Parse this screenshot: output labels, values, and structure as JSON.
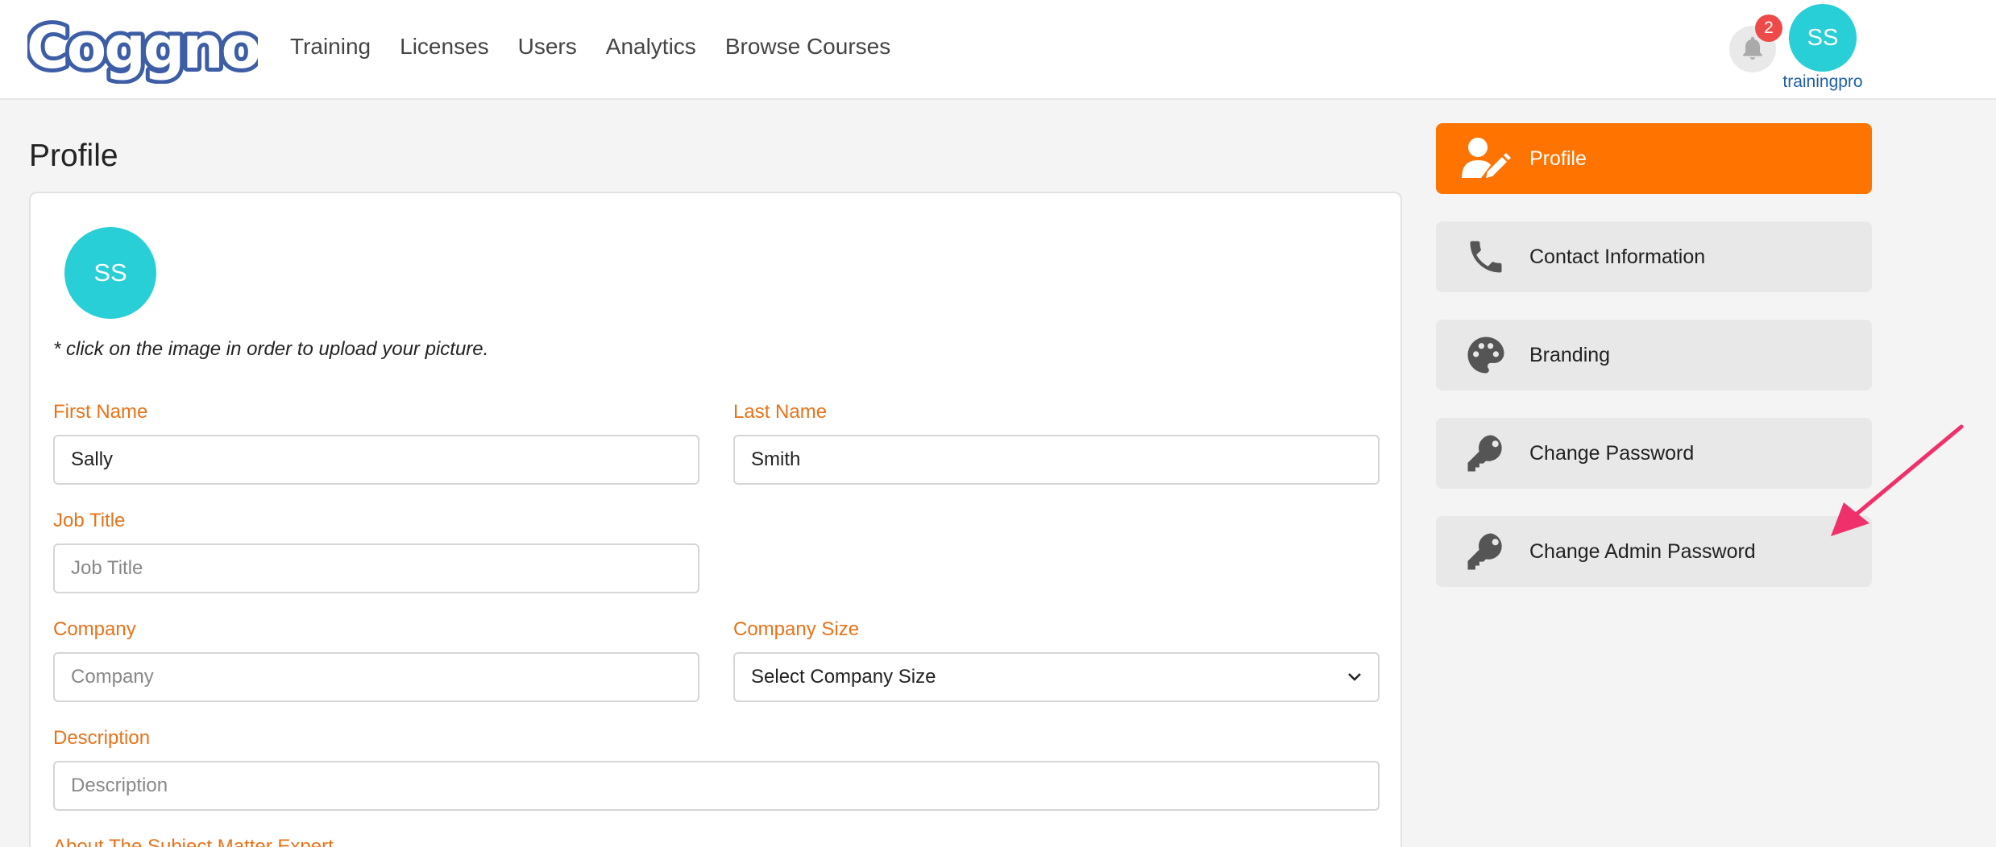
{
  "header": {
    "logo_text": "Coggno",
    "nav": [
      {
        "label": "Training"
      },
      {
        "label": "Licenses"
      },
      {
        "label": "Users"
      },
      {
        "label": "Analytics"
      },
      {
        "label": "Browse Courses"
      }
    ],
    "notification_count": "2",
    "avatar_initials": "SS",
    "username": "trainingpro"
  },
  "main": {
    "title": "Profile",
    "avatar_initials": "SS",
    "upload_hint": "* click on the image in order to upload your picture.",
    "fields": {
      "first_name": {
        "label": "First Name",
        "value": "Sally"
      },
      "last_name": {
        "label": "Last Name",
        "value": "Smith"
      },
      "job_title": {
        "label": "Job Title",
        "value": "",
        "placeholder": "Job Title"
      },
      "company": {
        "label": "Company",
        "value": "",
        "placeholder": "Company"
      },
      "company_size": {
        "label": "Company Size",
        "selected": "Select Company Size"
      },
      "description": {
        "label": "Description",
        "value": "",
        "placeholder": "Description"
      },
      "about_sme": {
        "label": "About The Subject Matter Expert"
      }
    }
  },
  "sidebar": {
    "items": [
      {
        "label": "Profile",
        "icon": "user-edit-icon",
        "active": true
      },
      {
        "label": "Contact Information",
        "icon": "phone-icon",
        "active": false
      },
      {
        "label": "Branding",
        "icon": "palette-icon",
        "active": false
      },
      {
        "label": "Change Password",
        "icon": "key-icon",
        "active": false
      },
      {
        "label": "Change Admin Password",
        "icon": "key-icon",
        "active": false
      }
    ]
  },
  "colors": {
    "accent_orange": "#ff7300",
    "label_orange": "#e8731a",
    "avatar_teal": "#29cfd6",
    "logo_blue": "#3d5ea6",
    "badge_red": "#ef4a4a",
    "annotation_arrow": "#f0306a"
  }
}
